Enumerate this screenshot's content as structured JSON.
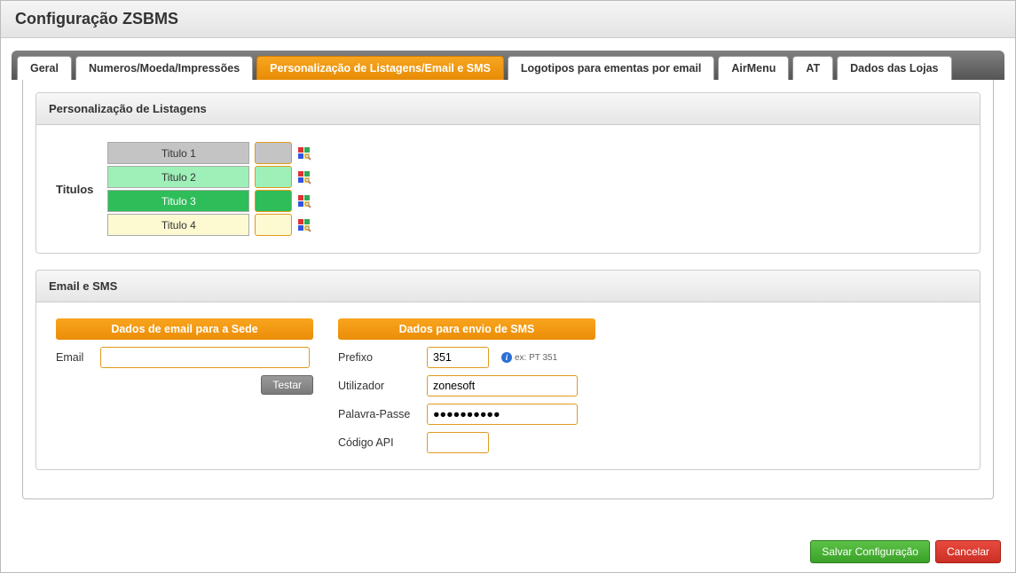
{
  "header": {
    "title": "Configuração ZSBMS"
  },
  "tabs": [
    {
      "label": "Geral"
    },
    {
      "label": "Numeros/Moeda/Impressões"
    },
    {
      "label": "Personalização de Listagens/Email e SMS",
      "active": true
    },
    {
      "label": "Logotipos para ementas por email"
    },
    {
      "label": "AirMenu"
    },
    {
      "label": "AT"
    },
    {
      "label": "Dados das Lojas"
    }
  ],
  "panel1": {
    "title": "Personalização de Listagens",
    "row_label": "Titulos",
    "items": [
      {
        "label": "Titulo 1",
        "bg": "#c4c4c4",
        "swatch": "#c4c4c4",
        "text": "#333333"
      },
      {
        "label": "Titulo 2",
        "bg": "#9ef0b8",
        "swatch": "#9ef0b8",
        "text": "#333333"
      },
      {
        "label": "Titulo 3",
        "bg": "#2ebd59",
        "swatch": "#2ebd59",
        "text": "#ffffff"
      },
      {
        "label": "Titulo 4",
        "bg": "#fdfad2",
        "swatch": "#fdfad2",
        "text": "#333333"
      }
    ]
  },
  "panel2": {
    "title": "Email e SMS",
    "col1": {
      "header": "Dados de email para a Sede",
      "email_label": "Email",
      "email_value": "",
      "test_button": "Testar"
    },
    "col2": {
      "header": "Dados para envio de SMS",
      "prefix_label": "Prefixo",
      "prefix_value": "351",
      "prefix_hint": "ex: PT 351",
      "user_label": "Utilizador",
      "user_value": "zonesoft",
      "pass_label": "Palavra-Passe",
      "pass_value": "●●●●●●●●●●",
      "api_label": "Código API",
      "api_value": ""
    }
  },
  "footer": {
    "save": "Salvar Configuração",
    "cancel": "Cancelar"
  }
}
